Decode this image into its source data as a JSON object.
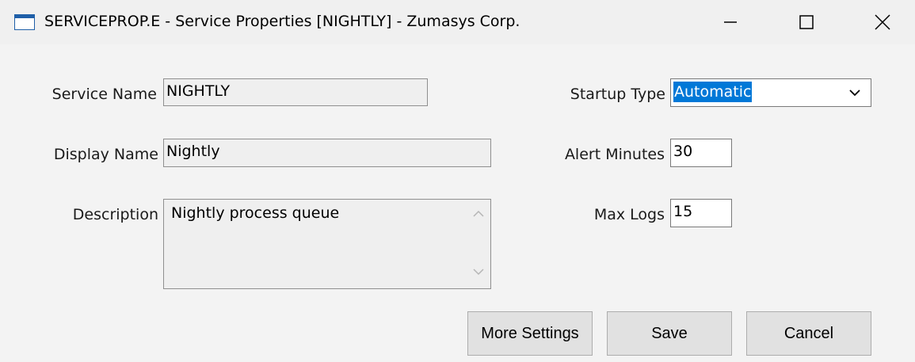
{
  "window": {
    "title": "SERVICEPROP.E - Service Properties [NIGHTLY] - Zumasys Corp."
  },
  "form": {
    "service_name_label": "Service Name",
    "service_name_value": "NIGHTLY",
    "display_name_label": "Display Name",
    "display_name_value": "Nightly",
    "description_label": "Description",
    "description_value": "Nightly process queue",
    "startup_type_label": "Startup Type",
    "startup_type_value": "Automatic",
    "alert_minutes_label": "Alert Minutes",
    "alert_minutes_value": "30",
    "max_logs_label": "Max Logs",
    "max_logs_value": "15"
  },
  "buttons": {
    "more_settings": "More Settings",
    "save": "Save",
    "cancel": "Cancel"
  },
  "icons": {
    "app": "window-icon",
    "minimize": "minimize-icon",
    "maximize": "maximize-icon",
    "close": "close-icon",
    "dropdown": "chevron-down-icon",
    "scroll_up": "scroll-up-icon",
    "scroll_down": "scroll-down-icon"
  },
  "colors": {
    "selection": "#0078d7",
    "app_icon": "#1f5fa8"
  }
}
